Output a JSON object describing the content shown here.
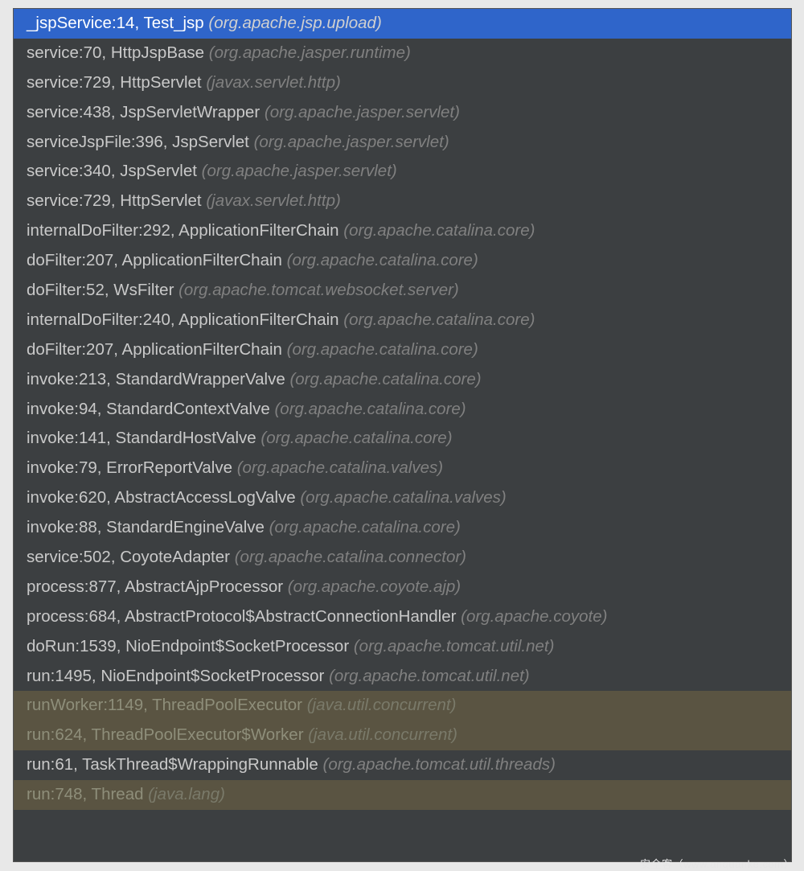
{
  "watermark": "安全客（www.anquanke.com）",
  "frames": [
    {
      "method": "_jspService:14, Test_jsp",
      "pkg": "(org.apache.jsp.upload)",
      "state": "selected"
    },
    {
      "method": "service:70, HttpJspBase",
      "pkg": "(org.apache.jasper.runtime)",
      "state": "normal"
    },
    {
      "method": "service:729, HttpServlet",
      "pkg": "(javax.servlet.http)",
      "state": "normal"
    },
    {
      "method": "service:438, JspServletWrapper",
      "pkg": "(org.apache.jasper.servlet)",
      "state": "normal"
    },
    {
      "method": "serviceJspFile:396, JspServlet",
      "pkg": "(org.apache.jasper.servlet)",
      "state": "normal"
    },
    {
      "method": "service:340, JspServlet",
      "pkg": "(org.apache.jasper.servlet)",
      "state": "normal"
    },
    {
      "method": "service:729, HttpServlet",
      "pkg": "(javax.servlet.http)",
      "state": "normal"
    },
    {
      "method": "internalDoFilter:292, ApplicationFilterChain",
      "pkg": "(org.apache.catalina.core)",
      "state": "normal"
    },
    {
      "method": "doFilter:207, ApplicationFilterChain",
      "pkg": "(org.apache.catalina.core)",
      "state": "normal"
    },
    {
      "method": "doFilter:52, WsFilter",
      "pkg": "(org.apache.tomcat.websocket.server)",
      "state": "normal"
    },
    {
      "method": "internalDoFilter:240, ApplicationFilterChain",
      "pkg": "(org.apache.catalina.core)",
      "state": "normal"
    },
    {
      "method": "doFilter:207, ApplicationFilterChain",
      "pkg": "(org.apache.catalina.core)",
      "state": "normal"
    },
    {
      "method": "invoke:213, StandardWrapperValve",
      "pkg": "(org.apache.catalina.core)",
      "state": "normal"
    },
    {
      "method": "invoke:94, StandardContextValve",
      "pkg": "(org.apache.catalina.core)",
      "state": "normal"
    },
    {
      "method": "invoke:141, StandardHostValve",
      "pkg": "(org.apache.catalina.core)",
      "state": "normal"
    },
    {
      "method": "invoke:79, ErrorReportValve",
      "pkg": "(org.apache.catalina.valves)",
      "state": "normal"
    },
    {
      "method": "invoke:620, AbstractAccessLogValve",
      "pkg": "(org.apache.catalina.valves)",
      "state": "normal"
    },
    {
      "method": "invoke:88, StandardEngineValve",
      "pkg": "(org.apache.catalina.core)",
      "state": "normal"
    },
    {
      "method": "service:502, CoyoteAdapter",
      "pkg": "(org.apache.catalina.connector)",
      "state": "normal"
    },
    {
      "method": "process:877, AbstractAjpProcessor",
      "pkg": "(org.apache.coyote.ajp)",
      "state": "normal"
    },
    {
      "method": "process:684, AbstractProtocol$AbstractConnectionHandler",
      "pkg": "(org.apache.coyote)",
      "state": "normal"
    },
    {
      "method": "doRun:1539, NioEndpoint$SocketProcessor",
      "pkg": "(org.apache.tomcat.util.net)",
      "state": "normal"
    },
    {
      "method": "run:1495, NioEndpoint$SocketProcessor",
      "pkg": "(org.apache.tomcat.util.net)",
      "state": "normal"
    },
    {
      "method": "runWorker:1149, ThreadPoolExecutor",
      "pkg": "(java.util.concurrent)",
      "state": "muted"
    },
    {
      "method": "run:624, ThreadPoolExecutor$Worker",
      "pkg": "(java.util.concurrent)",
      "state": "muted"
    },
    {
      "method": "run:61, TaskThread$WrappingRunnable",
      "pkg": "(org.apache.tomcat.util.threads)",
      "state": "normal"
    },
    {
      "method": "run:748, Thread",
      "pkg": "(java.lang)",
      "state": "muted"
    }
  ]
}
